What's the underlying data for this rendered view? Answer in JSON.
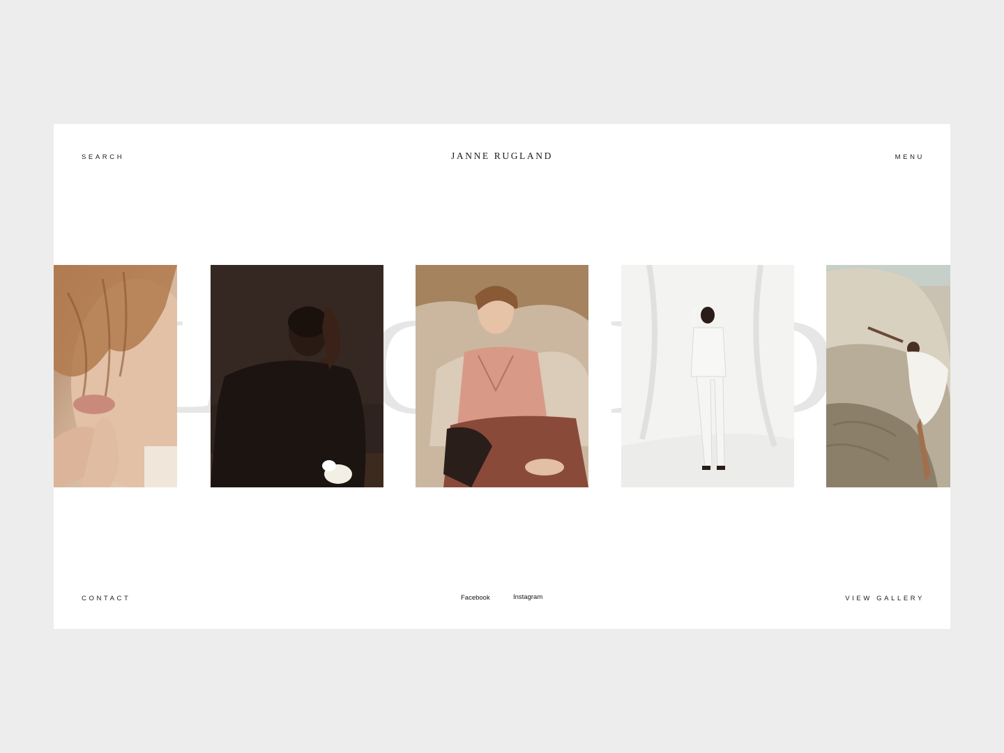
{
  "header": {
    "search_label": "SEARCH",
    "brand": "JANNE RUGLAND",
    "menu_label": "MENU"
  },
  "carousel": {
    "watermark_text": "LEGEND",
    "photos": [
      {
        "name": "close-up-face-hand",
        "dominant_color": "#c9a68a"
      },
      {
        "name": "portrait-dark-background",
        "dominant_color": "#2b211d"
      },
      {
        "name": "portrait-reclining-pillows",
        "dominant_color": "#bfa993"
      },
      {
        "name": "full-length-white-suit",
        "dominant_color": "#e9e9e8"
      },
      {
        "name": "figure-on-rock",
        "dominant_color": "#c7bfae"
      }
    ]
  },
  "footer": {
    "contact_label": "CONTACT",
    "facebook_label": "Facebook",
    "instagram_label": "Instagram",
    "view_gallery_label": "VIEW GALLERY"
  },
  "colors": {
    "page_background": "#ededed",
    "card_background": "#ffffff",
    "text": "#1a1a1a",
    "watermark": "#e6e6e6"
  }
}
